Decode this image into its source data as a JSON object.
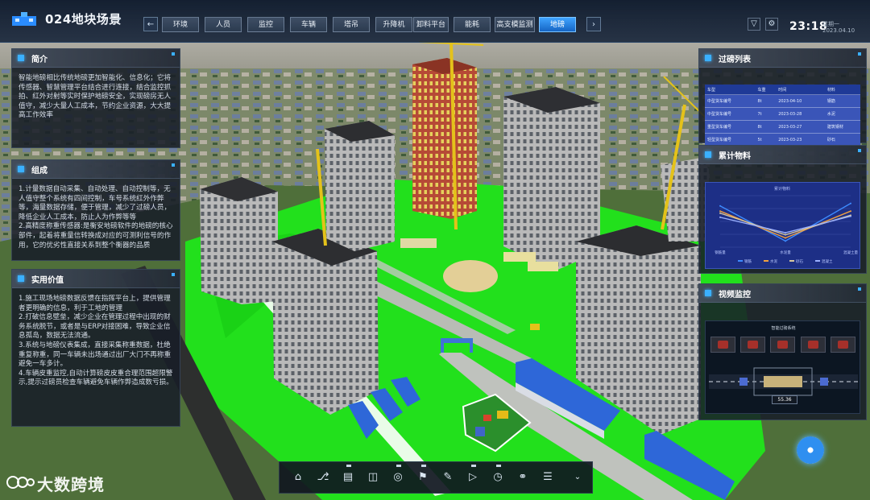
{
  "header": {
    "title": "024地块场景",
    "tabs": [
      {
        "label": "环境",
        "active": false
      },
      {
        "label": "人员",
        "active": false
      },
      {
        "label": "监控",
        "active": false
      },
      {
        "label": "车辆",
        "active": false
      },
      {
        "label": "塔吊",
        "active": false
      },
      {
        "label": "升降机",
        "active": false
      },
      {
        "label": "卸料平台",
        "active": false
      },
      {
        "label": "能耗",
        "active": false
      },
      {
        "label": "高支模监测",
        "active": false
      },
      {
        "label": "地磅",
        "active": true
      }
    ],
    "time": "23:18",
    "weekday": "星期一",
    "date": "2023.04.10",
    "icons": [
      "filter-icon",
      "settings-icon"
    ]
  },
  "intro": {
    "title": "简介",
    "text": "智能地磅相比传统地磅更加智能化、信息化；它将传感器、智慧管理平台结合进行连接，结合监控抓拍、红外对射等实时保护地磅安全，实现磅房无人值守，减少大量人工成本，节约企业资源，大大提高工作效率"
  },
  "composition": {
    "title": "组成",
    "text": "1.计量数据自动采集、自动处理、自动控制等，无人值守整个系统有四间控制，车号系统红外作弊等，海量数据存储，便于管理，减少了过磅人员，降低企业人工成本，防止人为作弊等等\n2.高精度称重传感器:是衡安地磅软件的地磅的核心部件，起着将重量信转换成对应的可测利信号的作用，它的优劣性直接关系到整个衡器的品质"
  },
  "value": {
    "title": "实用价值",
    "text": "1.施工现场地磅数据反馈在指挥平台上，提供管理者更明确的信息，利于工地的管理\n2.打破信息壁垒，减少企业在管理过程中出现的财务系统脱节，或者是与ERP对接困难，导致企业信息孤岛，数据无法流通。\n3.系统与地磅仪表集成，直接采集称重数据，杜绝重复称重，同一车辆未出场通过出厂大门不再称重避免一车多计。\n4.车辆皮重监控,自动计算磅皮皮重合理范围超限警示,提示过磅员检查车辆避免车辆作弊造成数亏损。"
  },
  "weighbridge_list": {
    "title": "过磅列表",
    "columns": [
      "车型",
      "车重",
      "时间",
      "材料"
    ],
    "rows": [
      [
        "中型货车编号",
        "8t",
        "2023-04-10",
        "钢筋"
      ],
      [
        "中型货车编号",
        "7t",
        "2023-03-28",
        "水泥"
      ],
      [
        "重型货车编号",
        "8t",
        "2023-03-27",
        "建筑钢材"
      ],
      [
        "轻型货车编号",
        "5t",
        "2023-03-23",
        "砂石"
      ]
    ]
  },
  "materials": {
    "title": "累计物料",
    "chart_title": "累计物料",
    "legend": [
      "钢筋",
      "水泥",
      "砂石",
      "混凝土"
    ]
  },
  "chart_data": {
    "type": "line",
    "title": "累计物料",
    "categories": [
      "钢筋量",
      "水泥量",
      "混凝土量"
    ],
    "series": [
      {
        "name": "钢筋",
        "values": [
          80,
          12,
          85
        ],
        "color": "#3d8bff"
      },
      {
        "name": "水泥",
        "values": [
          70,
          18,
          70
        ],
        "color": "#f0a040"
      },
      {
        "name": "砂石",
        "values": [
          66,
          24,
          62
        ],
        "color": "#d7c7a0"
      },
      {
        "name": "混凝土",
        "values": [
          58,
          28,
          60
        ],
        "color": "#9ab0ff"
      }
    ],
    "ylim": [
      0,
      100
    ]
  },
  "video": {
    "title": "视频监控",
    "screen_title": "智能过磅系统",
    "reading": "55.36"
  },
  "toolbar": {
    "icons": [
      "home-icon",
      "network-icon",
      "barrier-icon",
      "book-icon",
      "location-pin-icon",
      "flag-icon",
      "edit-icon",
      "camera-icon",
      "globe-icon",
      "planet-icon",
      "sliders-icon",
      "collapse-icon"
    ]
  },
  "watermark": {
    "text": "大数跨境"
  }
}
